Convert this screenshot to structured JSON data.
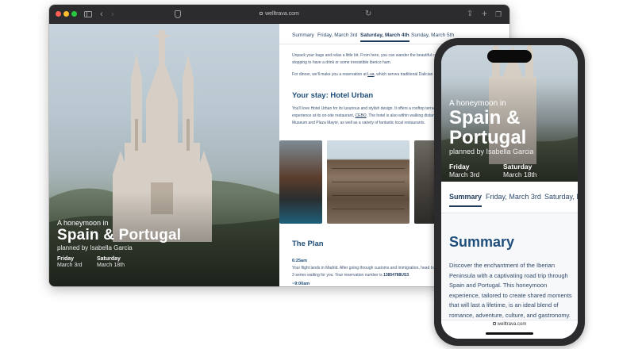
{
  "browser": {
    "url": "welltrava.com"
  },
  "hero": {
    "kicker": "A honeymoon in",
    "title": "Spain & Portugal",
    "byline": "planned by Isabella Garcia",
    "start_day": "Friday",
    "start_date": "March 3rd",
    "end_day": "Saturday",
    "end_date": "March 18th"
  },
  "content": {
    "tabs": [
      "Summary",
      "Friday, March 3rd",
      "Saturday, March 4th",
      "Sunday, March 5th"
    ],
    "intro_line1": "Unpack your bags and relax a little bit. From here, you can wander the beautiful cent",
    "intro_line2": "stopping to have a drink or some irresistible iberico ham.",
    "dinner_pre": "For dinner, we'll make you a reservation at ",
    "dinner_place": "Lua",
    "dinner_post": ", which serves traditional Dalician di",
    "stay_heading": "Your stay: Hotel Urban",
    "stay_line1": "You'll love Hotel Urban for its luxurious and stylish design. It offers a rooftop terrac",
    "stay_line2_pre": "experience at its on-site restaurant, ",
    "stay_restaurant": "CEBO",
    "stay_line2_post": ". The hotel is also within walking distanc",
    "stay_line3": "Museum and Plaza Mayor, as well as a variety of fantastic local restaurants.",
    "plan_heading": "The Plan",
    "plan_time1": "6:25am",
    "plan_line1": "Your flight lands in Madrid. After going through customs and immigration, head to the",
    "plan_line2_pre": "2-series waiting for you. Your reservation number is ",
    "plan_reservation": "13854788US3",
    "plan_line2_post": ".",
    "plan_time2": "~9:00am"
  },
  "phone": {
    "kicker": "A honeymoon in",
    "title": "Spain & Portugal",
    "byline": "planned by Isabella Garcia",
    "start_day": "Friday",
    "start_date": "March 3rd",
    "end_day": "Saturday",
    "end_date": "March 18th",
    "tabs": [
      "Summary",
      "Friday, March 3rd",
      "Saturday, M"
    ],
    "summary_heading": "Summary",
    "summary_body": "Discover the enchantment of the Iberian Peninsula with a captivating road trip through Spain and Portugal. This honeymoon experience, tailored to create shared moments that will last a lifetime, is an ideal blend of romance, adventure, culture, and gastronomy.",
    "url": "welltrava.com"
  }
}
